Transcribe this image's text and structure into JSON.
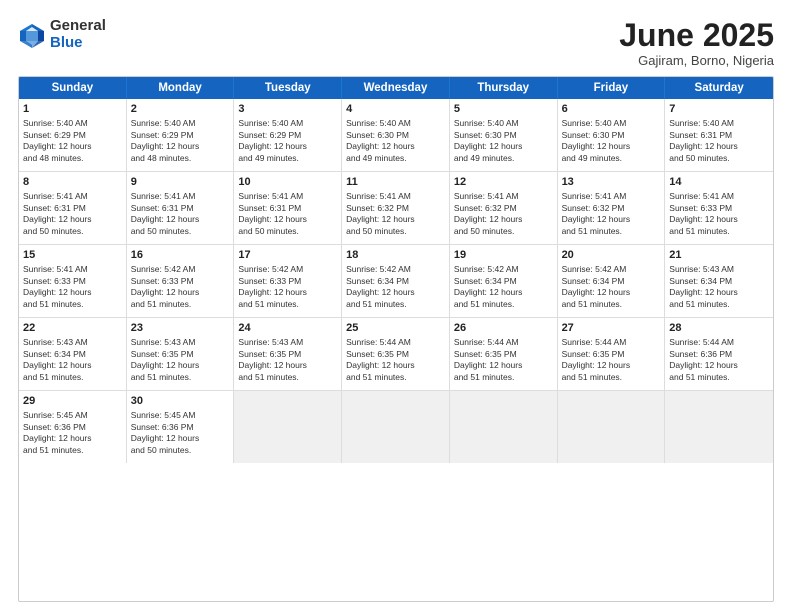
{
  "logo": {
    "general": "General",
    "blue": "Blue"
  },
  "header": {
    "month": "June 2025",
    "location": "Gajiram, Borno, Nigeria"
  },
  "weekdays": [
    "Sunday",
    "Monday",
    "Tuesday",
    "Wednesday",
    "Thursday",
    "Friday",
    "Saturday"
  ],
  "rows": [
    [
      {
        "day": "1",
        "info": "Sunrise: 5:40 AM\nSunset: 6:29 PM\nDaylight: 12 hours\nand 48 minutes.",
        "empty": false
      },
      {
        "day": "2",
        "info": "Sunrise: 5:40 AM\nSunset: 6:29 PM\nDaylight: 12 hours\nand 48 minutes.",
        "empty": false
      },
      {
        "day": "3",
        "info": "Sunrise: 5:40 AM\nSunset: 6:29 PM\nDaylight: 12 hours\nand 49 minutes.",
        "empty": false
      },
      {
        "day": "4",
        "info": "Sunrise: 5:40 AM\nSunset: 6:30 PM\nDaylight: 12 hours\nand 49 minutes.",
        "empty": false
      },
      {
        "day": "5",
        "info": "Sunrise: 5:40 AM\nSunset: 6:30 PM\nDaylight: 12 hours\nand 49 minutes.",
        "empty": false
      },
      {
        "day": "6",
        "info": "Sunrise: 5:40 AM\nSunset: 6:30 PM\nDaylight: 12 hours\nand 49 minutes.",
        "empty": false
      },
      {
        "day": "7",
        "info": "Sunrise: 5:40 AM\nSunset: 6:31 PM\nDaylight: 12 hours\nand 50 minutes.",
        "empty": false
      }
    ],
    [
      {
        "day": "8",
        "info": "Sunrise: 5:41 AM\nSunset: 6:31 PM\nDaylight: 12 hours\nand 50 minutes.",
        "empty": false
      },
      {
        "day": "9",
        "info": "Sunrise: 5:41 AM\nSunset: 6:31 PM\nDaylight: 12 hours\nand 50 minutes.",
        "empty": false
      },
      {
        "day": "10",
        "info": "Sunrise: 5:41 AM\nSunset: 6:31 PM\nDaylight: 12 hours\nand 50 minutes.",
        "empty": false
      },
      {
        "day": "11",
        "info": "Sunrise: 5:41 AM\nSunset: 6:32 PM\nDaylight: 12 hours\nand 50 minutes.",
        "empty": false
      },
      {
        "day": "12",
        "info": "Sunrise: 5:41 AM\nSunset: 6:32 PM\nDaylight: 12 hours\nand 50 minutes.",
        "empty": false
      },
      {
        "day": "13",
        "info": "Sunrise: 5:41 AM\nSunset: 6:32 PM\nDaylight: 12 hours\nand 51 minutes.",
        "empty": false
      },
      {
        "day": "14",
        "info": "Sunrise: 5:41 AM\nSunset: 6:33 PM\nDaylight: 12 hours\nand 51 minutes.",
        "empty": false
      }
    ],
    [
      {
        "day": "15",
        "info": "Sunrise: 5:41 AM\nSunset: 6:33 PM\nDaylight: 12 hours\nand 51 minutes.",
        "empty": false
      },
      {
        "day": "16",
        "info": "Sunrise: 5:42 AM\nSunset: 6:33 PM\nDaylight: 12 hours\nand 51 minutes.",
        "empty": false
      },
      {
        "day": "17",
        "info": "Sunrise: 5:42 AM\nSunset: 6:33 PM\nDaylight: 12 hours\nand 51 minutes.",
        "empty": false
      },
      {
        "day": "18",
        "info": "Sunrise: 5:42 AM\nSunset: 6:34 PM\nDaylight: 12 hours\nand 51 minutes.",
        "empty": false
      },
      {
        "day": "19",
        "info": "Sunrise: 5:42 AM\nSunset: 6:34 PM\nDaylight: 12 hours\nand 51 minutes.",
        "empty": false
      },
      {
        "day": "20",
        "info": "Sunrise: 5:42 AM\nSunset: 6:34 PM\nDaylight: 12 hours\nand 51 minutes.",
        "empty": false
      },
      {
        "day": "21",
        "info": "Sunrise: 5:43 AM\nSunset: 6:34 PM\nDaylight: 12 hours\nand 51 minutes.",
        "empty": false
      }
    ],
    [
      {
        "day": "22",
        "info": "Sunrise: 5:43 AM\nSunset: 6:34 PM\nDaylight: 12 hours\nand 51 minutes.",
        "empty": false
      },
      {
        "day": "23",
        "info": "Sunrise: 5:43 AM\nSunset: 6:35 PM\nDaylight: 12 hours\nand 51 minutes.",
        "empty": false
      },
      {
        "day": "24",
        "info": "Sunrise: 5:43 AM\nSunset: 6:35 PM\nDaylight: 12 hours\nand 51 minutes.",
        "empty": false
      },
      {
        "day": "25",
        "info": "Sunrise: 5:44 AM\nSunset: 6:35 PM\nDaylight: 12 hours\nand 51 minutes.",
        "empty": false
      },
      {
        "day": "26",
        "info": "Sunrise: 5:44 AM\nSunset: 6:35 PM\nDaylight: 12 hours\nand 51 minutes.",
        "empty": false
      },
      {
        "day": "27",
        "info": "Sunrise: 5:44 AM\nSunset: 6:35 PM\nDaylight: 12 hours\nand 51 minutes.",
        "empty": false
      },
      {
        "day": "28",
        "info": "Sunrise: 5:44 AM\nSunset: 6:36 PM\nDaylight: 12 hours\nand 51 minutes.",
        "empty": false
      }
    ],
    [
      {
        "day": "29",
        "info": "Sunrise: 5:45 AM\nSunset: 6:36 PM\nDaylight: 12 hours\nand 51 minutes.",
        "empty": false
      },
      {
        "day": "30",
        "info": "Sunrise: 5:45 AM\nSunset: 6:36 PM\nDaylight: 12 hours\nand 50 minutes.",
        "empty": false
      },
      {
        "day": "",
        "info": "",
        "empty": true
      },
      {
        "day": "",
        "info": "",
        "empty": true
      },
      {
        "day": "",
        "info": "",
        "empty": true
      },
      {
        "day": "",
        "info": "",
        "empty": true
      },
      {
        "day": "",
        "info": "",
        "empty": true
      }
    ]
  ]
}
